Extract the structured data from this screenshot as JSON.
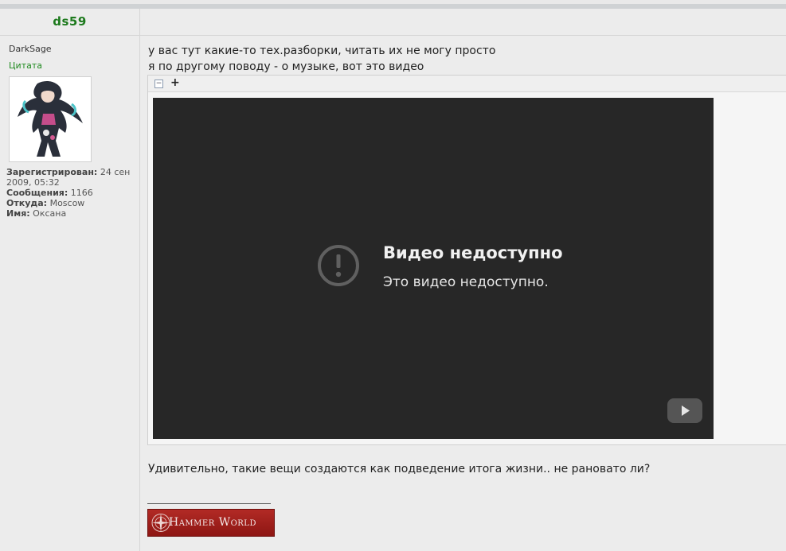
{
  "post": {
    "username": "ds59",
    "rank": "DarkSage",
    "quote_label": "Цитата",
    "info": {
      "registered_label": "Зарегистрирован:",
      "registered_value": "24 сен 2009, 05:32",
      "posts_label": "Сообщения:",
      "posts_value": "1166",
      "from_label": "Откуда:",
      "from_value": "Moscow",
      "name_label": "Имя:",
      "name_value": "Оксана"
    },
    "lines": [
      "у вас тут какие-то тех.разборки, читать их не могу просто",
      "я по другому поводу - о музыке, вот это видео"
    ],
    "after_text": "Удивительно, такие вещи создаются как подведение итога жизни.. не рановато ли?",
    "signature_line": "_________________"
  },
  "video": {
    "toolbar_minus": "−",
    "toolbar_plus": "+",
    "error_title": "Видео недоступно",
    "error_subtitle": "Это видео недоступно.",
    "error_icon": "exclamation-circle-icon",
    "logo_icon": "youtube-play-icon"
  },
  "banner": {
    "text": "Hammer World",
    "icon": "compass-rose-icon",
    "color": "#a3201c"
  }
}
